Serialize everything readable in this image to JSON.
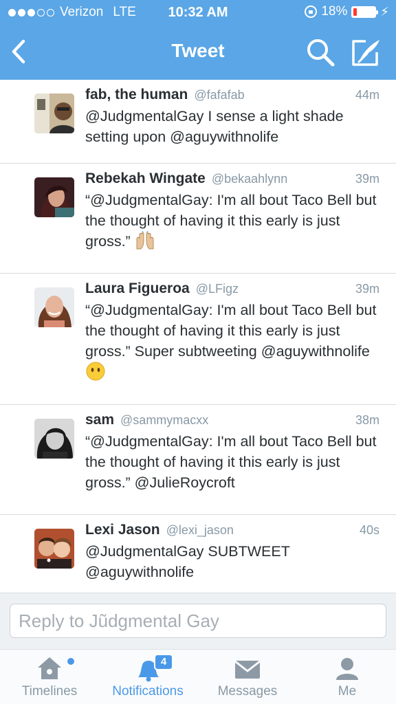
{
  "status_bar": {
    "carrier": "Verizon",
    "network": "LTE",
    "time": "10:32 AM",
    "battery": "18%",
    "battery_level": 0.18,
    "signal_bars_filled": 3,
    "signal_bars_total": 5
  },
  "nav": {
    "title": "Tweet",
    "icons": [
      "back-chevron-icon",
      "search-icon",
      "compose-icon"
    ]
  },
  "tweets": [
    {
      "name": "fab, the human",
      "handle": "@fafafab",
      "time": "44m",
      "text": "@JudgmentalGay I sense a light shade setting upon @aguywithnolife"
    },
    {
      "name": "Rebekah Wingate",
      "handle": "@bekaahlynn",
      "time": "39m",
      "text": "“@JudgmentalGay: I'm all bout Taco Bell but the thought of having it this early is just gross.”",
      "emoji": "raised-hands-emoji"
    },
    {
      "name": "Laura Figueroa",
      "handle": "@LFigz",
      "time": "39m",
      "text": "“@JudgmentalGay: I'm all bout Taco Bell but the thought of having it this early is just gross.” Super subtweeting @aguywithnolife",
      "emoji": "no-mouth-face-emoji"
    },
    {
      "name": "sam",
      "handle": "@sammymacxx",
      "time": "38m",
      "text": "“@JudgmentalGay: I'm all bout Taco Bell but the thought of having it this early is just gross.” @JulieRoycroft"
    },
    {
      "name": "Lexi Jason",
      "handle": "@lexi_jason",
      "time": "40s",
      "text": "@JudgmentalGay SUBTWEET @aguywithnolife"
    }
  ],
  "reply": {
    "placeholder": "Reply to Jũdgmental Gay"
  },
  "tabbar": {
    "timelines": "Timelines",
    "notifications": "Notifications",
    "notifications_badge": "4",
    "messages": "Messages",
    "me": "Me",
    "active_tab": "Notifications"
  },
  "colors": {
    "header": "#5aa6e6",
    "accent": "#4a99e9",
    "battery_low": "#ff3b30",
    "muted_text": "#8899a6"
  }
}
